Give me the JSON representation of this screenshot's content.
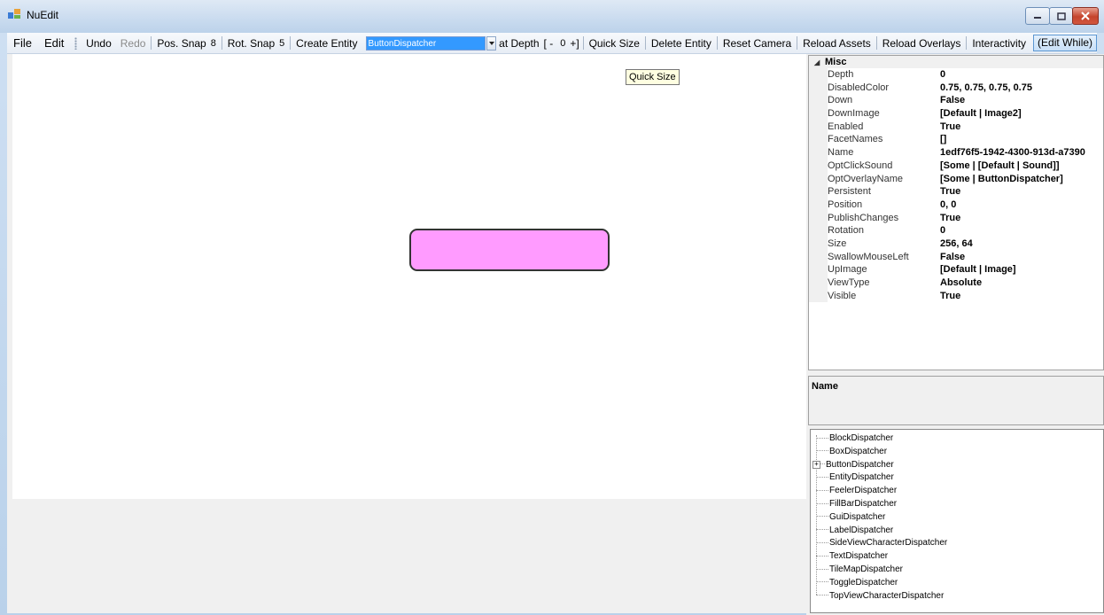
{
  "window": {
    "title": "NuEdit"
  },
  "toolbar": {
    "file": "File",
    "edit": "Edit",
    "undo": "Undo",
    "redo": "Redo",
    "pos_snap_label": "Pos. Snap",
    "pos_snap_value": "8",
    "rot_snap_label": "Rot. Snap",
    "rot_snap_value": "5",
    "create_entity": "Create Entity",
    "entity_type": "ButtonDispatcher",
    "at_depth": "at Depth",
    "depth_minus": "[ -",
    "depth_value": "0",
    "depth_plus": "+]",
    "quick_size": "Quick Size",
    "delete_entity": "Delete Entity",
    "reset_camera": "Reset Camera",
    "reload_assets": "Reload Assets",
    "reload_overlays": "Reload Overlays",
    "interactivity": "Interactivity",
    "edit_while": "(Edit While)"
  },
  "tooltip": {
    "text": "Quick Size"
  },
  "canvas": {
    "entity_color": "#ff9bff"
  },
  "properties": {
    "category": "Misc",
    "rows": [
      {
        "name": "Depth",
        "value": "0"
      },
      {
        "name": "DisabledColor",
        "value": "0.75, 0.75, 0.75, 0.75"
      },
      {
        "name": "Down",
        "value": "False"
      },
      {
        "name": "DownImage",
        "value": "[Default | Image2]"
      },
      {
        "name": "Enabled",
        "value": "True"
      },
      {
        "name": "FacetNames",
        "value": "[]"
      },
      {
        "name": "Name",
        "value": "1edf76f5-1942-4300-913d-a7390"
      },
      {
        "name": "OptClickSound",
        "value": "[Some | [Default | Sound]]"
      },
      {
        "name": "OptOverlayName",
        "value": "[Some | ButtonDispatcher]"
      },
      {
        "name": "Persistent",
        "value": "True"
      },
      {
        "name": "Position",
        "value": "0, 0"
      },
      {
        "name": "PublishChanges",
        "value": "True"
      },
      {
        "name": "Rotation",
        "value": "0"
      },
      {
        "name": "Size",
        "value": "256, 64"
      },
      {
        "name": "SwallowMouseLeft",
        "value": "False"
      },
      {
        "name": "UpImage",
        "value": "[Default | Image]"
      },
      {
        "name": "ViewType",
        "value": "Absolute"
      },
      {
        "name": "Visible",
        "value": "True"
      }
    ]
  },
  "description": {
    "title": "Name"
  },
  "tree": {
    "items": [
      {
        "label": "BlockDispatcher",
        "expandable": false
      },
      {
        "label": "BoxDispatcher",
        "expandable": false
      },
      {
        "label": "ButtonDispatcher",
        "expandable": true
      },
      {
        "label": "EntityDispatcher",
        "expandable": false
      },
      {
        "label": "FeelerDispatcher",
        "expandable": false
      },
      {
        "label": "FillBarDispatcher",
        "expandable": false
      },
      {
        "label": "GuiDispatcher",
        "expandable": false
      },
      {
        "label": "LabelDispatcher",
        "expandable": false
      },
      {
        "label": "SideViewCharacterDispatcher",
        "expandable": false
      },
      {
        "label": "TextDispatcher",
        "expandable": false
      },
      {
        "label": "TileMapDispatcher",
        "expandable": false
      },
      {
        "label": "ToggleDispatcher",
        "expandable": false
      },
      {
        "label": "TopViewCharacterDispatcher",
        "expandable": false
      }
    ]
  }
}
